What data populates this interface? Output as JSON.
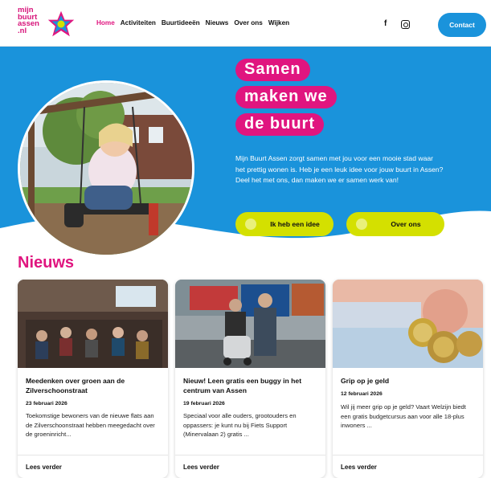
{
  "brand": {
    "logo_text": "mijn\nbuurt\nassen\n.nl",
    "pink": "#e0157f",
    "blue": "#1a93db",
    "lime": "#d4e000"
  },
  "nav": {
    "items": [
      "Home",
      "Activiteiten",
      "Buurtideeën",
      "Nieuws",
      "Over ons",
      "Wijken"
    ],
    "active": "Home"
  },
  "social": {
    "facebook_icon": "f",
    "instagram_icon": "instagram-icon"
  },
  "header": {
    "contact_label": "Contact"
  },
  "hero": {
    "title_lines": [
      "Samen",
      "maken we",
      "de buurt"
    ],
    "text": "Mijn Buurt Assen zorgt samen met jou voor een mooie stad waar het prettig wonen is. Heb je een leuk idee voor jouw buurt in Assen? Deel het met ons, dan maken we er samen werk van!",
    "button_idea": "Ik heb een idee",
    "button_about": "Over ons"
  },
  "news": {
    "heading": "Nieuws",
    "read_more": "Lees verder",
    "items": [
      {
        "title": "Meedenken over groen aan de Zilverschoonstraat",
        "date": "23 februari 2026",
        "desc": "Toekomstige bewoners van de nieuwe flats aan de Zilverschoonstraat hebben meegedacht over de groeninricht..."
      },
      {
        "title": "Nieuw! Leen gratis een buggy in het centrum van Assen",
        "date": "19 februari 2026",
        "desc": "Speciaal voor alle ouders, grootouders en oppassers: je kunt nu bij Fiets Support (Minervalaan 2) gratis ..."
      },
      {
        "title": "Grip op je geld",
        "date": "12 februari 2026",
        "desc": "Wil jij meer grip op je geld? Vaart Welzijn biedt een gratis budgetcursus aan voor alle 18-plus inwoners ..."
      }
    ]
  }
}
